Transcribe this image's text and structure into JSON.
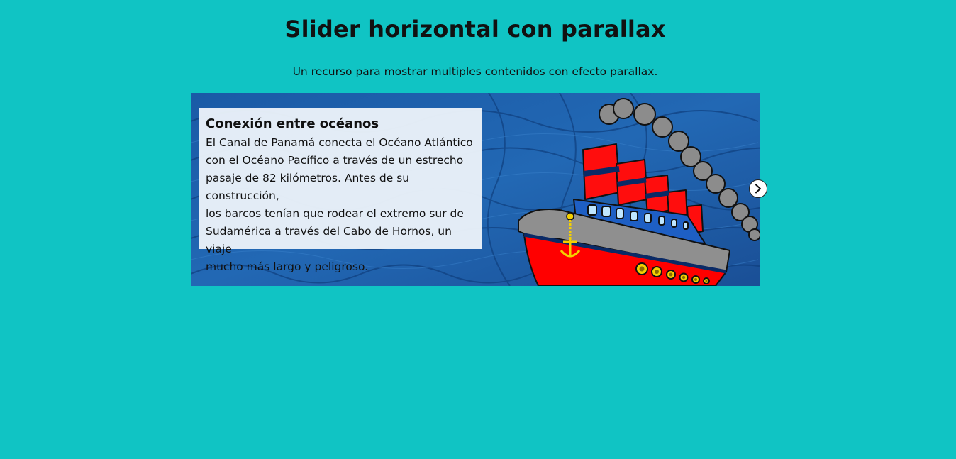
{
  "header": {
    "title": "Slider horizontal con parallax",
    "subtitle": "Un recurso para mostrar multiples contenidos con efecto parallax."
  },
  "slider": {
    "current_slide": {
      "heading": "Conexión entre océanos",
      "lines": [
        "El Canal de Panamá conecta el Océano Atlántico",
        "con el Océano Pacífico a través de un estrecho",
        "pasaje de 82 kilómetros. Antes de su construcción,",
        "los barcos tenían que rodear el extremo sur de",
        "Sudamérica a través del Cabo de Hornos, un viaje",
        "mucho más largo y peligroso."
      ],
      "image": "cartoon-steamship"
    },
    "next_icon": "chevron-right-icon"
  },
  "colors": {
    "page_background": "#10c4c4",
    "slide_background": "#1c5ca8",
    "ship_hull": "#ff0000",
    "ship_deck": "#1e64c8",
    "smoke": "#8a8a8a",
    "anchor": "#f5d000"
  }
}
